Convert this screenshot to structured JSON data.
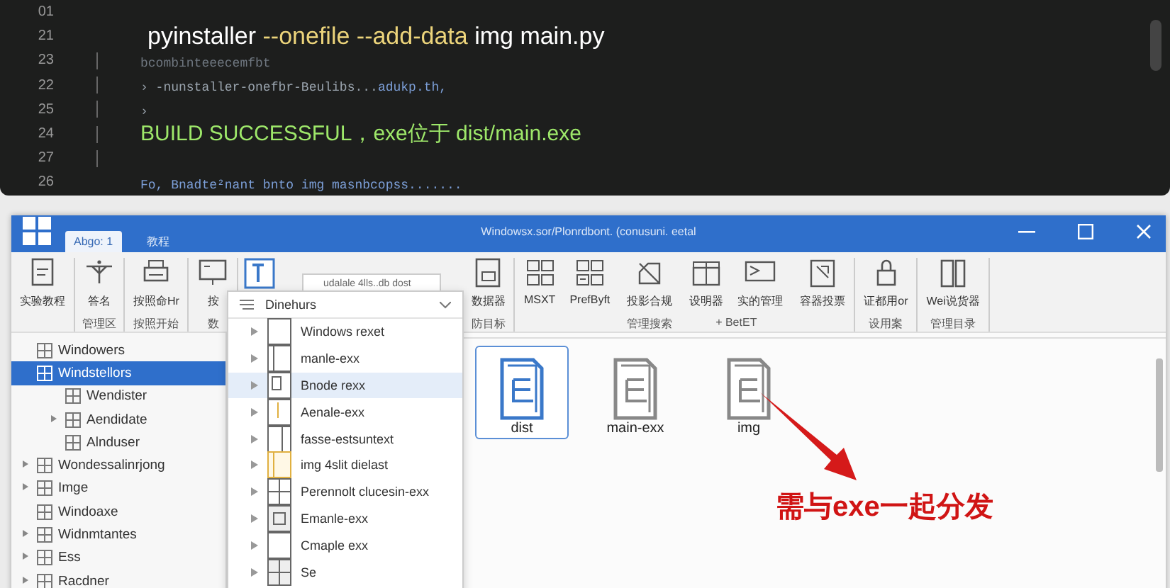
{
  "editor": {
    "lines": [
      {
        "number": "01",
        "guide": false
      },
      {
        "number": "21",
        "guide": false,
        "tokens": [
          {
            "text": "pyinstaller ",
            "kind": "command"
          },
          {
            "text": "--onefile ",
            "kind": "flag"
          },
          {
            "text": "--add-data ",
            "kind": "flag"
          },
          {
            "text": "img main.py",
            "kind": "command"
          }
        ]
      },
      {
        "number": "23",
        "guide": true,
        "tokens": [
          {
            "text": "bcombinteeecemfbt",
            "kind": "comment"
          }
        ]
      },
      {
        "number": "22",
        "guide": true,
        "tokens": [
          {
            "text": "› -nunstaller-onefbr-Beulibs...",
            "kind": "output"
          },
          {
            "text": "adukp.th,",
            "kind": "path"
          }
        ]
      },
      {
        "number": "25",
        "guide": true,
        "tokens": [
          {
            "text": "›",
            "kind": "output"
          }
        ]
      },
      {
        "number": "24",
        "guide": true,
        "tokens": [
          {
            "text": "BUILD SUCCESSFUL，exe位于 dist/main.exe",
            "kind": "success"
          }
        ]
      },
      {
        "number": "27",
        "guide": true
      },
      {
        "number": "26",
        "guide": false,
        "tokens": [
          {
            "text": "Fo, Bnadte²nant bnto img masnbcopss.......",
            "kind": "path"
          }
        ]
      }
    ]
  },
  "window": {
    "title": "Windowsx.sor/Plonrdbont. (conusuni. eetal",
    "tabs": [
      {
        "label": "Abgo: 1",
        "selected": true
      },
      {
        "label": "教程",
        "selected": false
      }
    ],
    "ribbon": [
      {
        "items": [
          "实验教程"
        ]
      },
      {
        "items": [
          "答名"
        ],
        "label": "管理区"
      },
      {
        "items": [
          "按照命Hr"
        ],
        "label": "按照开始"
      },
      {
        "items": [
          "按"
        ],
        "label": "数"
      },
      {
        "dropdown": true
      },
      {
        "items": [
          "数据器"
        ],
        "label": "防目标"
      },
      {
        "items": [
          "MSXT",
          "PrefByft"
        ]
      },
      {
        "items": [
          "投影合规"
        ],
        "label": "管理搜索"
      },
      {
        "items": [
          "设明器",
          "实的管理"
        ],
        "label": "+ BetET"
      },
      {
        "items": [
          "容器投票"
        ]
      },
      {
        "items": [
          "证都用or"
        ],
        "label": "设用案"
      },
      {
        "items": [
          "Wei说货器"
        ],
        "label": "管理目录"
      }
    ],
    "tooltip": "udalale 4lls..db dost",
    "sidebar": [
      {
        "label": "Windowers",
        "selected": false,
        "expandable": false
      },
      {
        "label": "Windstellors",
        "selected": true,
        "expandable": false,
        "children": [
          {
            "label": "Wendister",
            "selected": false,
            "expandable": false
          },
          {
            "label": "Aendidate",
            "selected": false,
            "expandable": true
          },
          {
            "label": "Alnduser",
            "selected": false,
            "expandable": false
          }
        ]
      },
      {
        "label": "Wondessalinrjong",
        "selected": false,
        "expandable": true
      },
      {
        "label": "Imge",
        "selected": false,
        "expandable": true
      },
      {
        "label": "Windoaxe",
        "selected": false,
        "expandable": false
      },
      {
        "label": "Widnmtantes",
        "selected": false,
        "expandable": true
      },
      {
        "label": "Ess",
        "selected": false,
        "expandable": true
      },
      {
        "label": "Racdner",
        "selected": false,
        "expandable": true
      }
    ],
    "dropdown": {
      "header": "Dinehurs",
      "items": [
        {
          "label": "Windows rexet",
          "selected": false
        },
        {
          "label": "manle-exx",
          "selected": false
        },
        {
          "label": "Bnode rexx",
          "selected": true
        },
        {
          "label": "Aenale-exx",
          "selected": false
        },
        {
          "label": "fasse-estsuntext",
          "selected": false
        },
        {
          "label": "img 4slit dielast",
          "selected": false
        },
        {
          "label": "Perennolt clucesin-exx",
          "selected": false
        },
        {
          "label": "Emanle-exx",
          "selected": false
        },
        {
          "label": "Cmaple exx",
          "selected": false
        },
        {
          "label": "Se",
          "selected": false
        }
      ]
    },
    "files": [
      {
        "name": "dist",
        "selected": true
      },
      {
        "name": "main-exx",
        "selected": false
      },
      {
        "name": "img",
        "selected": false
      }
    ],
    "annotation": "需与exe一起分发"
  }
}
